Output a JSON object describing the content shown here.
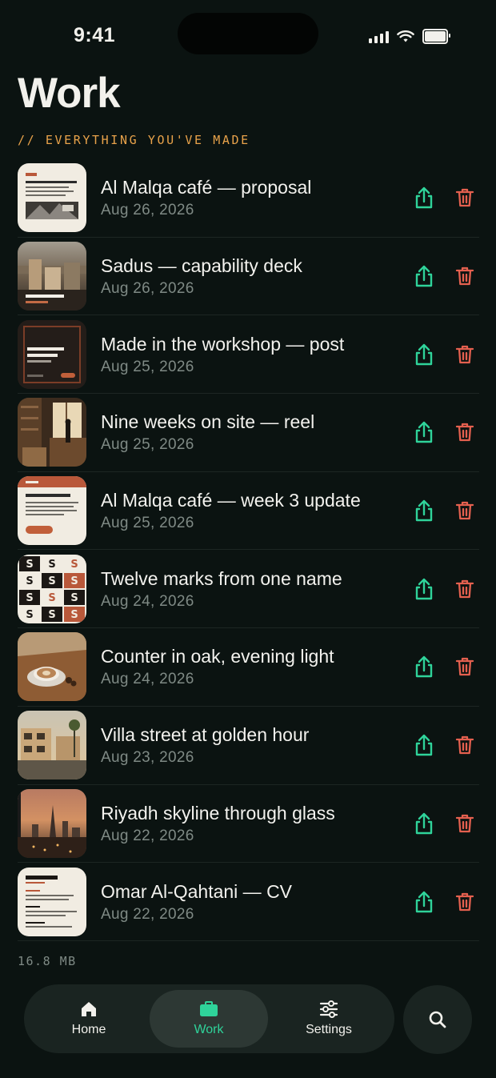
{
  "status_bar": {
    "time": "9:41"
  },
  "page": {
    "title": "Work",
    "subtitle": "// EVERYTHING YOU'VE MADE"
  },
  "items": [
    {
      "title": "Al Malqa café — proposal",
      "date": "Aug 26, 2026",
      "thumb": "document-proposal"
    },
    {
      "title": "Sadus — capability deck",
      "date": "Aug 26, 2026",
      "thumb": "photo-city-deck"
    },
    {
      "title": "Made in the workshop — post",
      "date": "Aug 25, 2026",
      "thumb": "dark-post"
    },
    {
      "title": "Nine weeks on site — reel",
      "date": "Aug 25, 2026",
      "thumb": "photo-cafe-interior"
    },
    {
      "title": "Al Malqa café — week 3 update",
      "date": "Aug 25, 2026",
      "thumb": "document-update"
    },
    {
      "title": "Twelve marks from one name",
      "date": "Aug 24, 2026",
      "thumb": "logo-grid"
    },
    {
      "title": "Counter in oak, evening light",
      "date": "Aug 24, 2026",
      "thumb": "photo-coffee"
    },
    {
      "title": "Villa street at golden hour",
      "date": "Aug 23, 2026",
      "thumb": "photo-villa-street"
    },
    {
      "title": "Riyadh skyline through glass",
      "date": "Aug 22, 2026",
      "thumb": "photo-skyline"
    },
    {
      "title": "Omar Al-Qahtani — CV",
      "date": "Aug 22, 2026",
      "thumb": "document-cv"
    }
  ],
  "footer": {
    "storage": "16.8 MB"
  },
  "tabbar": {
    "home": "Home",
    "work": "Work",
    "settings": "Settings",
    "active": "work"
  },
  "colors": {
    "background": "#0b1311",
    "accent_green": "#2fd39a",
    "delete_red": "#e4604f",
    "kicker_orange": "#e8a24a"
  }
}
